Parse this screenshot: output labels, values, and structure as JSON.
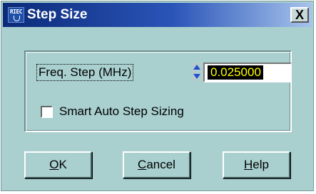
{
  "window": {
    "title": "Step Size",
    "icon": "riec-anchor-icon",
    "close_label": "X"
  },
  "freq": {
    "label": "Freq. Step (MHz)",
    "value": "0.025000"
  },
  "smart_step": {
    "label": "Smart Auto Step Sizing",
    "checked": false
  },
  "buttons": {
    "ok": {
      "mnemonic": "O",
      "rest": "K"
    },
    "cancel": {
      "mnemonic": "C",
      "rest": "ancel"
    },
    "help": {
      "mnemonic": "H",
      "rest": "elp"
    }
  },
  "app_icon_text": "RIEC",
  "colors": {
    "title_dark": "#0b2a78",
    "title_light": "#a7c3ec",
    "window_bg": "#a9cfcf",
    "value_bg": "#000000",
    "value_fg": "#ffff00",
    "spin_arrow": "#1f4fd0"
  }
}
